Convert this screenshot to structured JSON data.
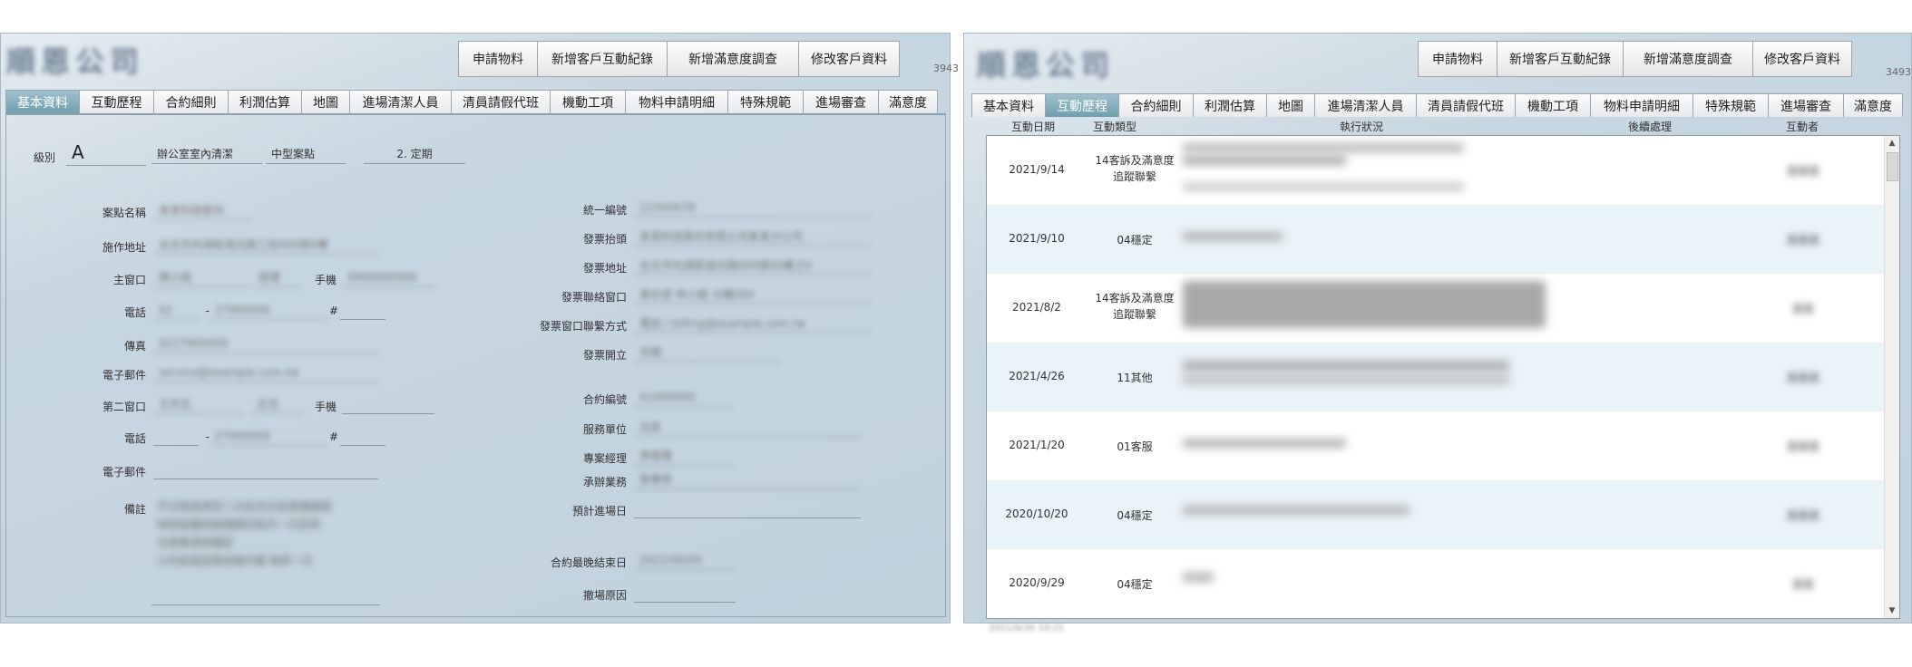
{
  "left": {
    "company_name": "順恩公司",
    "toolbar": [
      "申請物料",
      "新增客戶互動紀錄",
      "新增滿意度調查",
      "修改客戶資料"
    ],
    "record_count": "3943",
    "tabs": [
      "基本資料",
      "互動歷程",
      "合約細則",
      "利潤估算",
      "地圖",
      "進場清潔人員",
      "清員請假代班",
      "機動工項",
      "物料申請明細",
      "特殊規範",
      "進場審查",
      "滿意度"
    ],
    "active_tab": 0,
    "grade_label": "級別",
    "grade": "A",
    "service_type": "辦公室室內清潔",
    "site_size": "中型案點",
    "cycle": "2. 定期",
    "labels": {
      "site_name": "案點名稱",
      "address": "施作地址",
      "contact1": "主窗口",
      "mobile": "手機",
      "phone": "電話",
      "fax": "傳真",
      "email": "電子郵件",
      "contact2": "第二窗口",
      "note": "備註",
      "tax_id": "統一編號",
      "invoice_title": "發票抬頭",
      "invoice_address": "發票地址",
      "invoice_contact": "發票聯絡窗口",
      "invoice_contact_method": "發票窗口聯繫方式",
      "invoice_issue": "發票開立",
      "contract_no": "合約編號",
      "service_unit": "服務單位",
      "project_manager": "專案經理",
      "sales": "承辦業務",
      "expected_entry": "預計進場日",
      "contract_end": "合約最晚結束日",
      "exit_reason": "撤場原因"
    },
    "dash": "-",
    "hash": "#",
    "values": {
      "site_name": "某某科技股份",
      "address": "台北市內湖區瑞光路三段000號0樓",
      "contact1": "陳小姐",
      "contact1_title": "經理",
      "mobile": "0900000000",
      "phone_area": "02",
      "phone": "27900000",
      "fax": "0227900000",
      "email": "service@example.com.tw",
      "contact2": "王先生",
      "contact2_title": "主任",
      "phone2": "27900000",
      "note_lines": [
        "平日每週清潔二次並含垃圾清運處理",
        "地毯吸塵與玻璃擦拭每月一次安排",
        "注意事項待確認",
        "公共區域定期消毒作業 每季一次"
      ],
      "tax_id": "12345678",
      "invoice_title": "某某科技股份有限公司某某分公司",
      "invoice_address": "台北市內湖區瑞光路000號00樓之0",
      "invoice_contact": "會計部 林小姐 分機000",
      "invoice_contact_method": "電話 / billing@example.com.tw",
      "invoice_issue": "月開",
      "contract_no": "A1000000",
      "service_unit": "北區",
      "project_manager": "李經理",
      "sales": "張專員",
      "contract_end": "2022/00/00"
    }
  },
  "right": {
    "company_name": "順恩公司",
    "toolbar": [
      "申請物料",
      "新增客戶互動紀錄",
      "新增滿意度調查",
      "修改客戶資料"
    ],
    "record_count": "3493",
    "tabs": [
      "基本資料",
      "互動歷程",
      "合約細則",
      "利潤估算",
      "地圖",
      "進場清潔人員",
      "清員請假代班",
      "機動工項",
      "物料申請明細",
      "特殊規範",
      "進場審查",
      "滿意度"
    ],
    "active_tab": 1,
    "columns": [
      "互動日期",
      "互動類型",
      "執行狀況",
      "後續處理",
      "互動者"
    ],
    "rows": [
      {
        "date": "2021/9/14",
        "type_lines": [
          "14客訴及滿意度",
          "追蹤聯繫"
        ],
        "actor": "某某某"
      },
      {
        "date": "2021/9/10",
        "type_lines": [
          "04穩定"
        ],
        "actor": "某某某"
      },
      {
        "date": "2021/8/2",
        "type_lines": [
          "14客訴及滿意度",
          "追蹤聯繫"
        ],
        "actor": "某某"
      },
      {
        "date": "2021/4/26",
        "type_lines": [
          "11其他"
        ],
        "actor": "某某某"
      },
      {
        "date": "2021/1/20",
        "type_lines": [
          "01客服"
        ],
        "actor": "某某某"
      },
      {
        "date": "2020/10/20",
        "type_lines": [
          "04穩定"
        ],
        "actor": "某某某"
      },
      {
        "date": "2020/9/29",
        "type_lines": [
          "04穩定"
        ],
        "actor": "某某"
      }
    ],
    "footer": "2021/9/30 10:21"
  }
}
